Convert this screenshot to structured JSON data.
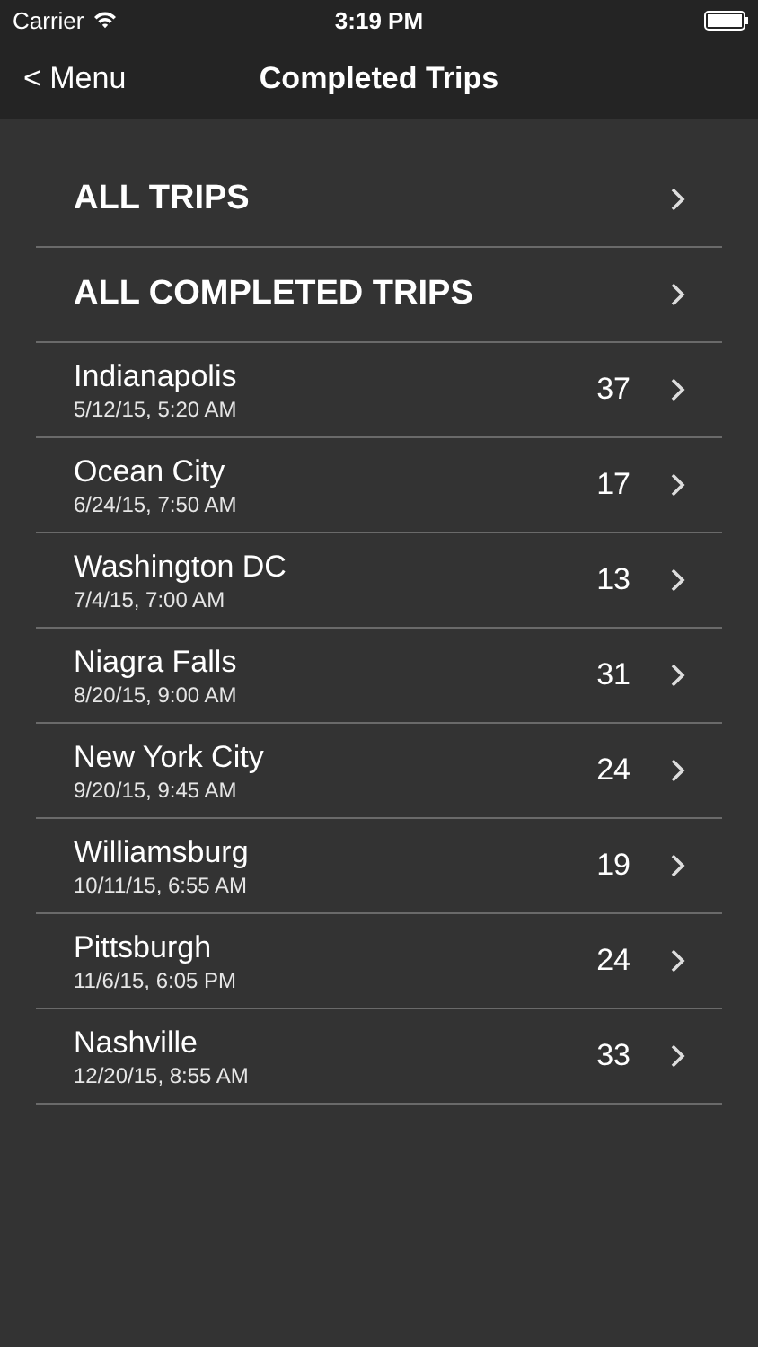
{
  "status_bar": {
    "carrier": "Carrier",
    "time": "3:19 PM"
  },
  "nav_bar": {
    "back": "< Menu",
    "title": "Completed Trips"
  },
  "sections": [
    {
      "label": "ALL TRIPS"
    },
    {
      "label": "ALL COMPLETED TRIPS"
    }
  ],
  "trips": [
    {
      "name": "Indianapolis",
      "date": "5/12/15, 5:20 AM",
      "count": "37"
    },
    {
      "name": "Ocean City",
      "date": "6/24/15, 7:50 AM",
      "count": "17"
    },
    {
      "name": "Washington DC",
      "date": "7/4/15, 7:00 AM",
      "count": "13"
    },
    {
      "name": "Niagra Falls",
      "date": "8/20/15, 9:00 AM",
      "count": "31"
    },
    {
      "name": "New York City",
      "date": "9/20/15, 9:45 AM",
      "count": "24"
    },
    {
      "name": "Williamsburg",
      "date": "10/11/15, 6:55 AM",
      "count": "19"
    },
    {
      "name": "Pittsburgh",
      "date": "11/6/15, 6:05 PM",
      "count": "24"
    },
    {
      "name": "Nashville",
      "date": "12/20/15, 8:55 AM",
      "count": "33"
    }
  ]
}
